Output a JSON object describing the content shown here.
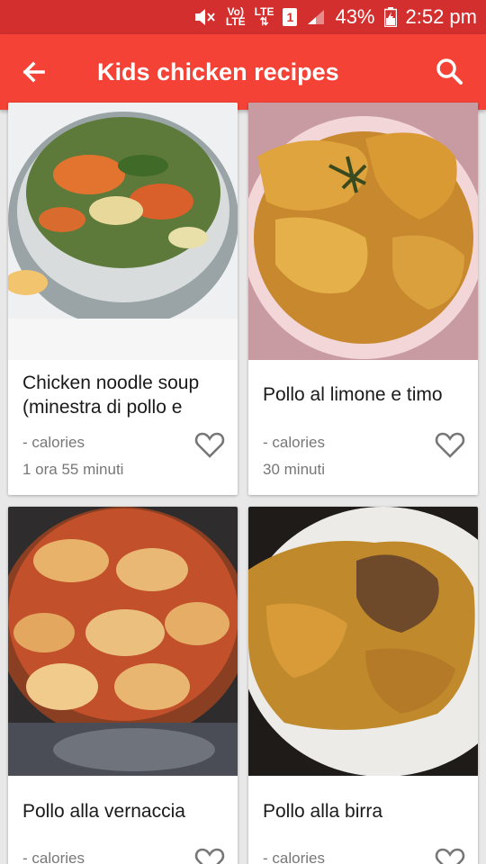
{
  "status_bar": {
    "network_label_top": "Vo)",
    "network_label_bottom": "LTE",
    "lte_label": "LTE",
    "sim_slot": "1",
    "battery": "43%",
    "time": "2:52 pm"
  },
  "app_bar": {
    "title": "Kids chicken recipes",
    "back_icon": "arrow-back-icon",
    "search_icon": "search-icon"
  },
  "recipes": [
    {
      "name": "Chicken noodle soup (minestra di pollo e",
      "calories": "- calories",
      "time": "1 ora 55 minuti"
    },
    {
      "name": "Pollo al limone e timo",
      "calories": "- calories",
      "time": "30 minuti"
    },
    {
      "name": "Pollo alla vernaccia",
      "calories": "- calories",
      "time": ""
    },
    {
      "name": "Pollo alla birra",
      "calories": "- calories",
      "time": ""
    }
  ],
  "colors": {
    "status_bar": "#d32f2f",
    "app_bar": "#f44336"
  }
}
